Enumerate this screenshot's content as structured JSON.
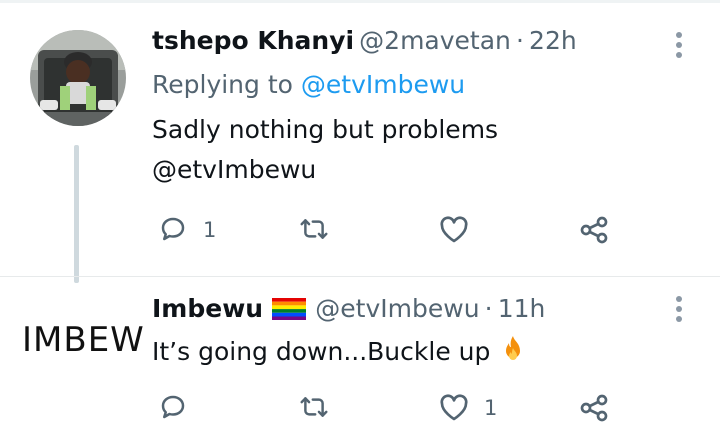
{
  "tweets": [
    {
      "display_name": "tshepo Khanyi",
      "handle": "@2mavetan",
      "separator": "·",
      "time": "22h",
      "replying_prefix": "Replying to",
      "replying_handle": "@etvImbewu",
      "text_line1": "Sadly nothing but problems",
      "text_line2": "@etvImbewu",
      "reply_count": "1",
      "retweet_count": "",
      "like_count": ""
    },
    {
      "display_name": "Imbewu",
      "badge": "rainbow-flag-emoji",
      "handle": "@etvImbewu",
      "separator": "·",
      "time": "11h",
      "text": "It’s going down...Buckle up",
      "text_emoji": "fire-emoji",
      "logo_text": "IMBEW",
      "reply_count": "",
      "retweet_count": "",
      "like_count": "1"
    }
  ],
  "colors": {
    "text": "#0f1419",
    "muted": "#536471",
    "link": "#1d9bf0",
    "divider": "#e7eaeb"
  }
}
